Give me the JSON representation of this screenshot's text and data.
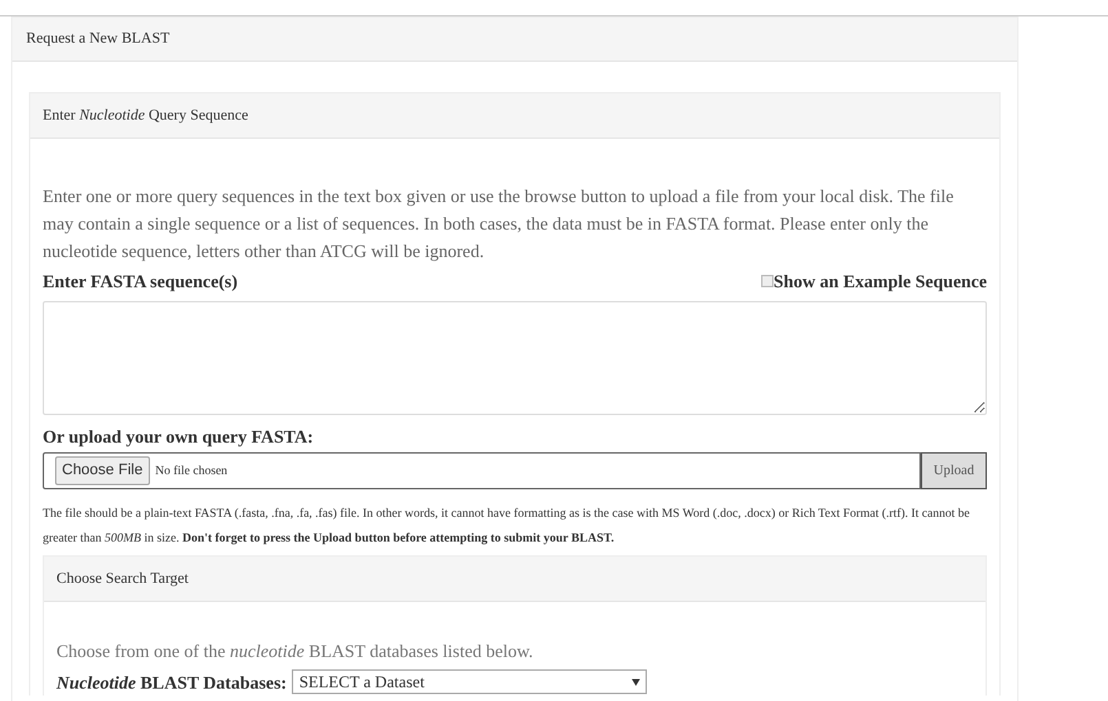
{
  "panel_title": "Request a New BLAST",
  "query_panel": {
    "title": "Enter *Nucleotide* Query Sequence",
    "intro": "Enter one or more query sequences in the text box given or use the browse button to upload a file from your local disk. The file may contain a single sequence or a list of sequences. In both cases, the data must be in FASTA format. Please enter only the nucleotide sequence, letters other than ATCG will be ignored.",
    "fasta_label": "Enter FASTA sequence(s)",
    "example_checkbox": {
      "label": "Show an Example Sequence",
      "checked": false
    },
    "upload_label": "Or upload your own query FASTA:",
    "choose_file_button": "Choose File",
    "file_status": "No file chosen",
    "upload_button": "Upload",
    "upload_note": "The file should be a plain-text FASTA (.fasta, .fna, .fa, .fas) file. In other words, it cannot have formatting as is the case with MS Word (.doc, .docx) or Rich Text Format (.rtf). It cannot be greater than *500MB* in size. **Don't forget to press the Upload button before attempting to submit your BLAST.**"
  },
  "target_panel": {
    "title": "Choose Search Target",
    "intro": "Choose from one of the *nucleotide* BLAST databases listed below.",
    "database_label": "*Nucleotide* BLAST Databases:",
    "database_select": "SELECT a Dataset"
  }
}
